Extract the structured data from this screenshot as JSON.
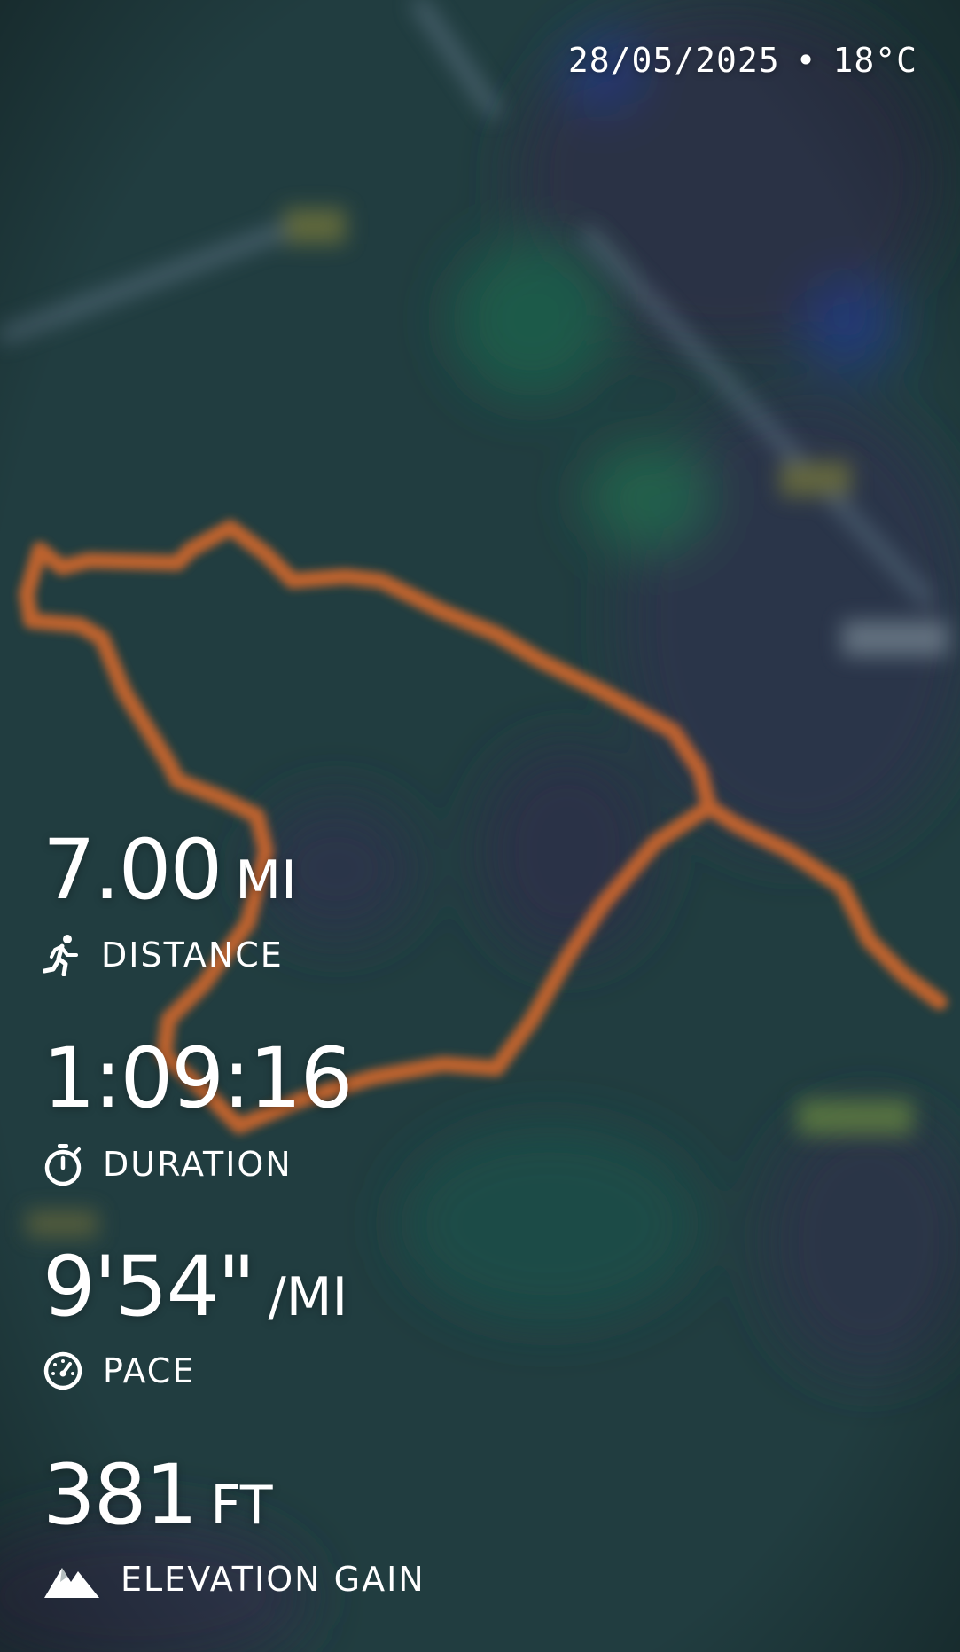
{
  "header": {
    "date": "28/05/2025",
    "separator": "•",
    "temperature": "18°C"
  },
  "stats": {
    "distance": {
      "value": "7.00",
      "unit": "MI",
      "label": "DISTANCE",
      "icon": "runner-icon"
    },
    "duration": {
      "value": "1:09:16",
      "label": "DURATION",
      "icon": "stopwatch-icon"
    },
    "pace": {
      "value": "9'54\"",
      "unit": "/MI",
      "label": "PACE",
      "icon": "speedometer-icon"
    },
    "elevation": {
      "value": "381",
      "unit": "FT",
      "label": "ELEVATION GAIN",
      "icon": "mountain-icon"
    }
  },
  "colors": {
    "route": "#d8692a",
    "map_base": "#1f3a3d",
    "text": "#ffffff"
  }
}
